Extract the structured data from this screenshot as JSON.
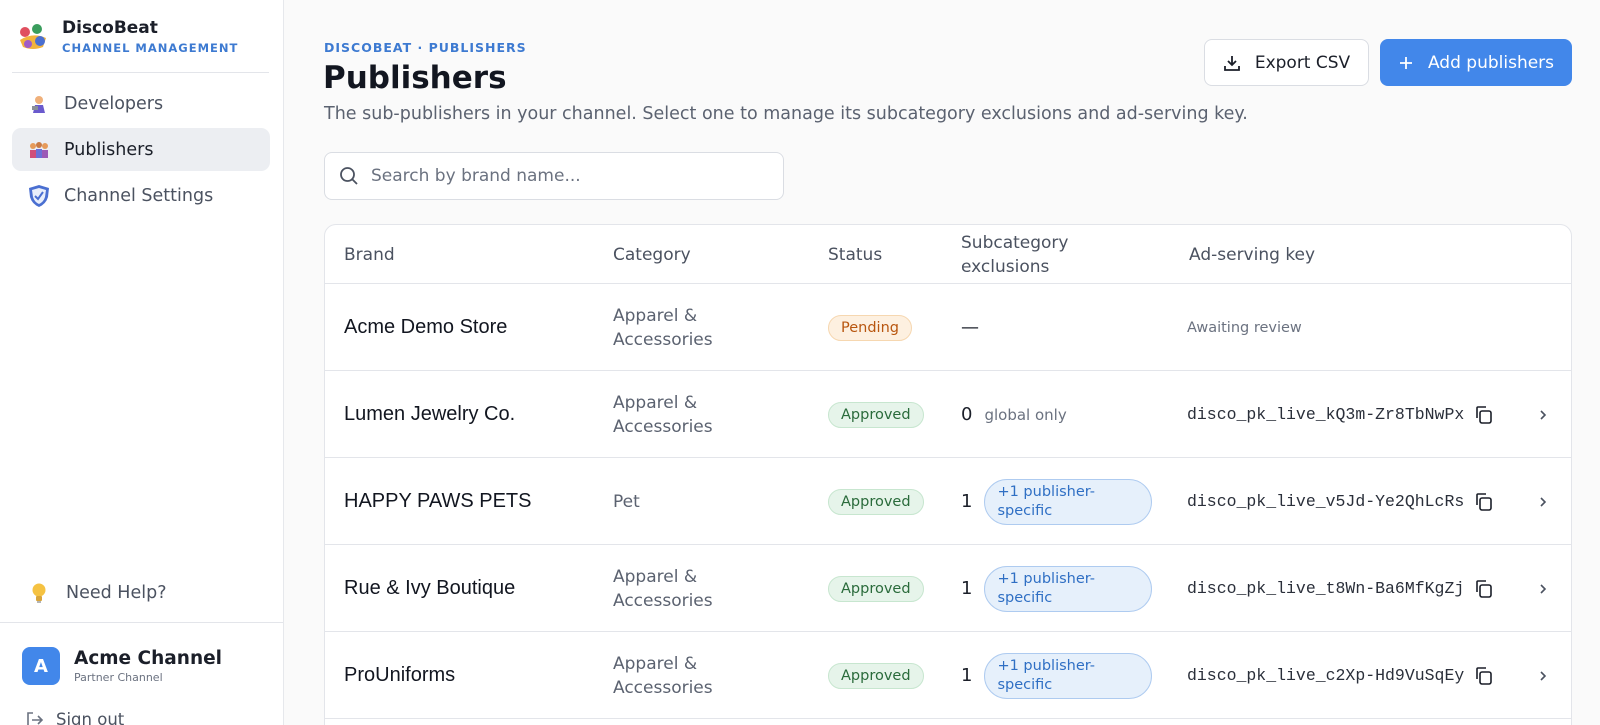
{
  "app": {
    "name": "DiscoBeat",
    "subtitle": "CHANNEL MANAGEMENT"
  },
  "sidebar": {
    "items": [
      {
        "label": "Developers",
        "icon": "developer-emoji-icon",
        "active": false
      },
      {
        "label": "Publishers",
        "icon": "people-emoji-icon",
        "active": true
      },
      {
        "label": "Channel Settings",
        "icon": "shield-icon",
        "active": false
      }
    ],
    "help": "Need Help?",
    "account": {
      "initial": "A",
      "name": "Acme Channel",
      "type": "Partner Channel"
    },
    "signout": "Sign out"
  },
  "header": {
    "breadcrumb": "DISCOBEAT · PUBLISHERS",
    "title": "Publishers",
    "subtitle": "The sub-publishers in your channel. Select one to manage its subcategory exclusions and ad-serving key.",
    "export_label": "Export CSV",
    "add_label": "Add publishers"
  },
  "search": {
    "placeholder": "Search by brand name...",
    "value": ""
  },
  "colors": {
    "accent": "#4287ea",
    "pending": "#b8560f",
    "approved": "#2a6b3b"
  },
  "table": {
    "columns": {
      "brand": "Brand",
      "category": "Category",
      "status": "Status",
      "exclusions": "Subcategory exclusions",
      "key": "Ad-serving key"
    },
    "rows": [
      {
        "brand": "Acme Demo Store",
        "category": "Apparel & Accessories",
        "status": "Pending",
        "exclusions": "—",
        "exclusions_note": "",
        "key": "Awaiting review"
      },
      {
        "brand": "Lumen Jewelry Co.",
        "category": "Apparel & Accessories",
        "status": "Approved",
        "exclusions": "0",
        "exclusions_note": "global only",
        "key": "disco_pk_live_kQ3m-Zr8TbNwPx"
      },
      {
        "brand": "HAPPY PAWS PETS",
        "category": "Pet",
        "status": "Approved",
        "exclusions": "1",
        "exclusions_note": "+1 publisher-specific",
        "key": "disco_pk_live_v5Jd-Ye2QhLcRs"
      },
      {
        "brand": "Rue & Ivy Boutique",
        "category": "Apparel & Accessories",
        "status": "Approved",
        "exclusions": "1",
        "exclusions_note": "+1 publisher-specific",
        "key": "disco_pk_live_t8Wn-Ba6MfKgZj"
      },
      {
        "brand": "ProUniforms",
        "category": "Apparel & Accessories",
        "status": "Approved",
        "exclusions": "1",
        "exclusions_note": "+1 publisher-specific",
        "key": "disco_pk_live_c2Xp-Hd9VuSqEy"
      }
    ]
  }
}
